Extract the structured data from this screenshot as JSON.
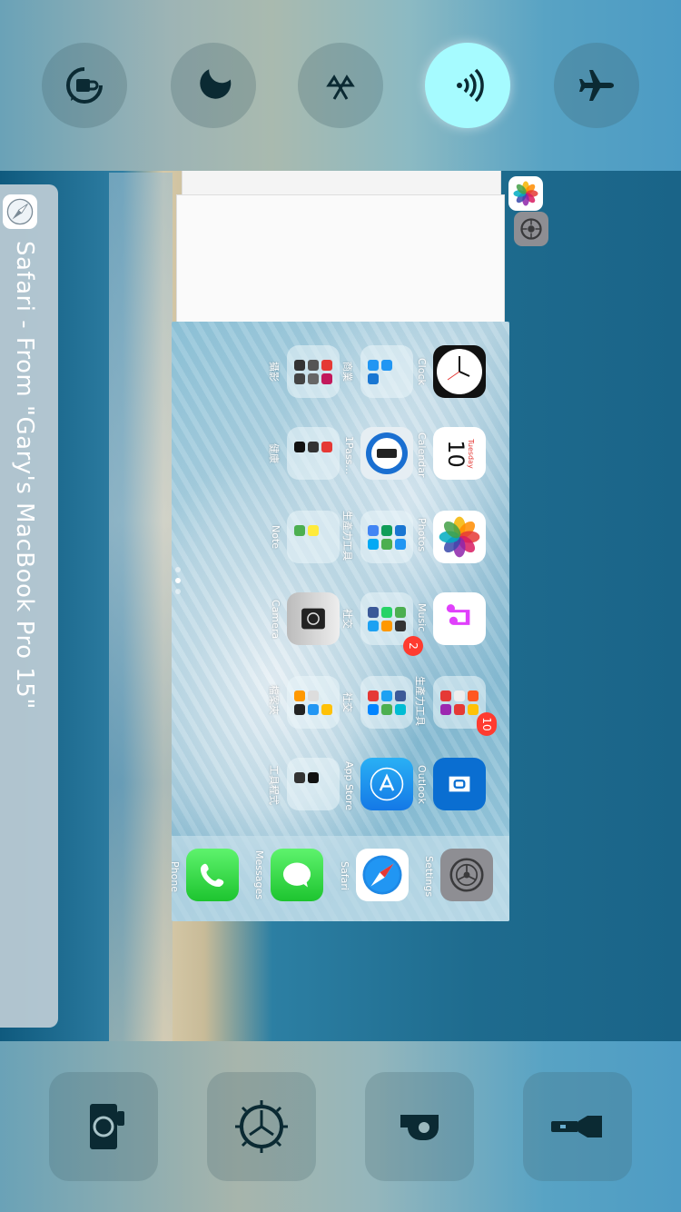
{
  "control_center": {
    "toggles": [
      {
        "name": "rotation-lock",
        "active": false
      },
      {
        "name": "do-not-disturb",
        "active": false
      },
      {
        "name": "bluetooth",
        "active": false
      },
      {
        "name": "airplay-audio",
        "active": true
      },
      {
        "name": "airplane-mode",
        "active": false
      }
    ],
    "shortcuts": [
      "camera",
      "timer",
      "torch-flashlight",
      "flashlight"
    ],
    "active_color": "#a6fbff"
  },
  "handoff": {
    "label": "Safari - From \"Gary's MacBook Pro 15\""
  },
  "home_screen": {
    "rows": [
      [
        {
          "label": "Clock",
          "kind": "clock"
        },
        {
          "label": "商業",
          "kind": "folder"
        },
        {
          "label": "攝影",
          "kind": "folder"
        }
      ],
      [
        {
          "label": "Calendar",
          "kind": "calendar",
          "day": "Tuesday",
          "date": "10"
        },
        {
          "label": "1Pass…",
          "kind": "onepassword"
        },
        {
          "label": "健康",
          "kind": "folder"
        }
      ],
      [
        {
          "label": "Photos",
          "kind": "photos"
        },
        {
          "label": "生產力工具",
          "kind": "folder"
        },
        {
          "label": "Note",
          "kind": "folder"
        }
      ],
      [
        {
          "label": "Music",
          "kind": "music"
        },
        {
          "label": "社交",
          "kind": "folder",
          "badge": "2"
        },
        {
          "label": "Camera",
          "kind": "camera"
        }
      ],
      [
        {
          "label": "生產力工具",
          "kind": "folder",
          "badge": "10"
        },
        {
          "label": "社交",
          "kind": "folder"
        },
        {
          "label": "檔案夾",
          "kind": "folder"
        }
      ],
      [
        {
          "label": "Outlook",
          "kind": "outlook"
        },
        {
          "label": "App Store",
          "kind": "appstore"
        },
        {
          "label": "工具程式",
          "kind": "folder"
        }
      ]
    ],
    "dock": [
      {
        "label": "Settings",
        "kind": "settings"
      },
      {
        "label": "Safari",
        "kind": "safari"
      },
      {
        "label": "Messages",
        "kind": "messages"
      },
      {
        "label": "Phone",
        "kind": "phone"
      }
    ]
  }
}
